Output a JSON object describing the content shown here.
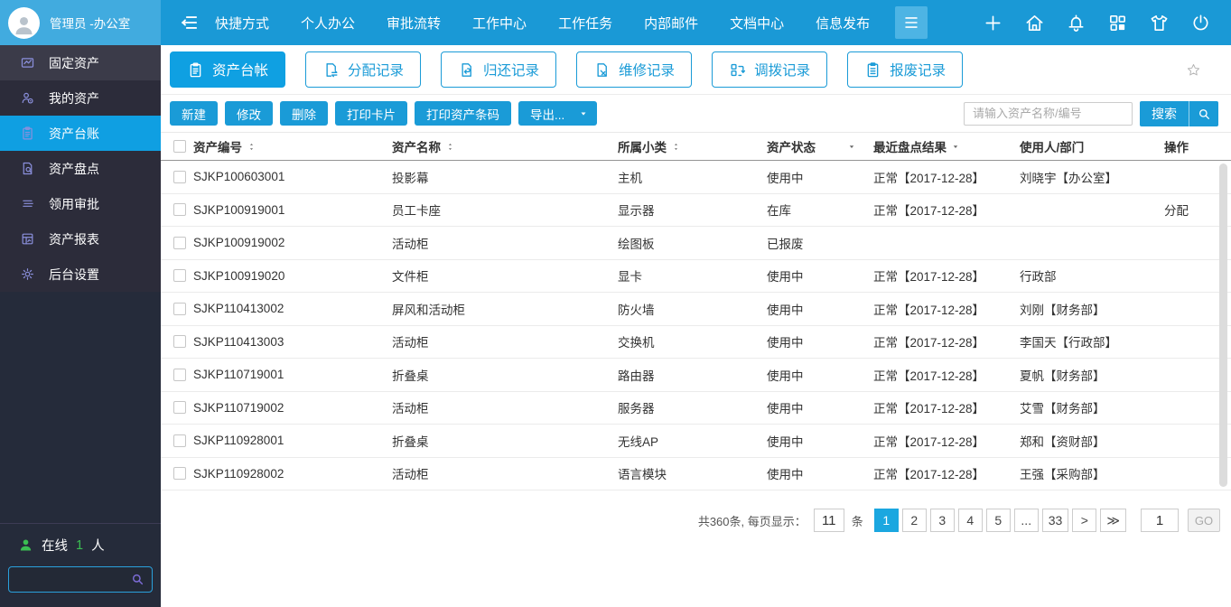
{
  "topbar": {
    "user": "管理员 -办公室",
    "nav": [
      {
        "label": "快捷方式"
      },
      {
        "label": "个人办公"
      },
      {
        "label": "审批流转"
      },
      {
        "label": "工作中心"
      },
      {
        "label": "工作任务"
      },
      {
        "label": "内部邮件"
      },
      {
        "label": "文档中心"
      },
      {
        "label": "信息发布"
      }
    ],
    "icons": [
      {
        "icon": "plus"
      },
      {
        "icon": "home"
      },
      {
        "icon": "bell"
      },
      {
        "icon": "grid"
      },
      {
        "icon": "shirt"
      },
      {
        "icon": "power"
      }
    ]
  },
  "sidebar": {
    "items": [
      {
        "label": "固定资产",
        "icon": "certificate",
        "header": true
      },
      {
        "label": "我的资产",
        "icon": "person-badge"
      },
      {
        "label": "资产台账",
        "icon": "clipboard",
        "selected": true
      },
      {
        "label": "资产盘点",
        "icon": "doc-search"
      },
      {
        "label": "领用审批",
        "icon": "stack"
      },
      {
        "label": "资产报表",
        "icon": "report"
      },
      {
        "label": "后台设置",
        "icon": "gear"
      }
    ],
    "online_label": "在线",
    "online_count": "1",
    "online_suffix": "人"
  },
  "tabs": [
    {
      "label": "资产台帐",
      "icon": "clipboard",
      "active": true
    },
    {
      "label": "分配记录",
      "icon": "doc-transfer"
    },
    {
      "label": "归还记录",
      "icon": "doc-return"
    },
    {
      "label": "维修记录",
      "icon": "doc-repair"
    },
    {
      "label": "调拨记录",
      "icon": "swap"
    },
    {
      "label": "报废记录",
      "icon": "scrap"
    }
  ],
  "toolbar": {
    "buttons": [
      "新建",
      "修改",
      "删除",
      "打印卡片",
      "打印资产条码"
    ],
    "export_label": "导出...",
    "search_placeholder": "请输入资产名称/编号",
    "search_button": "搜索"
  },
  "table": {
    "columns": [
      "资产编号",
      "资产名称",
      "所属小类",
      "资产状态",
      "最近盘点结果",
      "使用人/部门",
      "操作"
    ],
    "rows": [
      {
        "id": "SJKP100603001",
        "name": "投影幕",
        "category": "主机",
        "status": "使用中",
        "check": "正常【2017-12-28】",
        "user": "刘晓宇【办公室】",
        "action": ""
      },
      {
        "id": "SJKP100919001",
        "name": "员工卡座",
        "category": "显示器",
        "status": "在库",
        "check": "正常【2017-12-28】",
        "user": "",
        "action": "分配"
      },
      {
        "id": "SJKP100919002",
        "name": "活动柜",
        "category": "绘图板",
        "status": "已报废",
        "check": "",
        "user": "",
        "action": ""
      },
      {
        "id": "SJKP100919020",
        "name": "文件柜",
        "category": "显卡",
        "status": "使用中",
        "check": "正常【2017-12-28】",
        "user": "行政部",
        "action": ""
      },
      {
        "id": "SJKP110413002",
        "name": "屏风和活动柜",
        "category": "防火墙",
        "status": "使用中",
        "check": "正常【2017-12-28】",
        "user": "刘刚【财务部】",
        "action": ""
      },
      {
        "id": "SJKP110413003",
        "name": "活动柜",
        "category": "交换机",
        "status": "使用中",
        "check": "正常【2017-12-28】",
        "user": "李国天【行政部】",
        "action": ""
      },
      {
        "id": "SJKP110719001",
        "name": "折叠桌",
        "category": "路由器",
        "status": "使用中",
        "check": "正常【2017-12-28】",
        "user": "夏帆【财务部】",
        "action": ""
      },
      {
        "id": "SJKP110719002",
        "name": "活动柜",
        "category": "服务器",
        "status": "使用中",
        "check": "正常【2017-12-28】",
        "user": "艾雪【财务部】",
        "action": ""
      },
      {
        "id": "SJKP110928001",
        "name": "折叠桌",
        "category": "无线AP",
        "status": "使用中",
        "check": "正常【2017-12-28】",
        "user": "郑和【资财部】",
        "action": ""
      },
      {
        "id": "SJKP110928002",
        "name": "活动柜",
        "category": "语言模块",
        "status": "使用中",
        "check": "正常【2017-12-28】",
        "user": "王强【采购部】",
        "action": ""
      }
    ]
  },
  "pagination": {
    "total_text": "共360条, 每页显示：",
    "page_size": "11",
    "unit": "条",
    "pages": [
      {
        "label": "1",
        "active": true
      },
      {
        "label": "2"
      },
      {
        "label": "3"
      },
      {
        "label": "4"
      },
      {
        "label": "5"
      },
      {
        "label": "..."
      },
      {
        "label": "33"
      },
      {
        "label": ">"
      },
      {
        "label": "≫"
      }
    ],
    "goto_value": "1",
    "go_label": "GO"
  },
  "colors": {
    "topbar": "#1a99d6",
    "topbar_light": "#41abdf",
    "accent_blue": "#1a9bd7",
    "active_blue": "#0fa0e2",
    "sidebar_bg": "#252b3a",
    "sidebar_selected": "#0f9fe2",
    "online_green": "#3bbf52",
    "icon_purple": "#8b90dd"
  }
}
